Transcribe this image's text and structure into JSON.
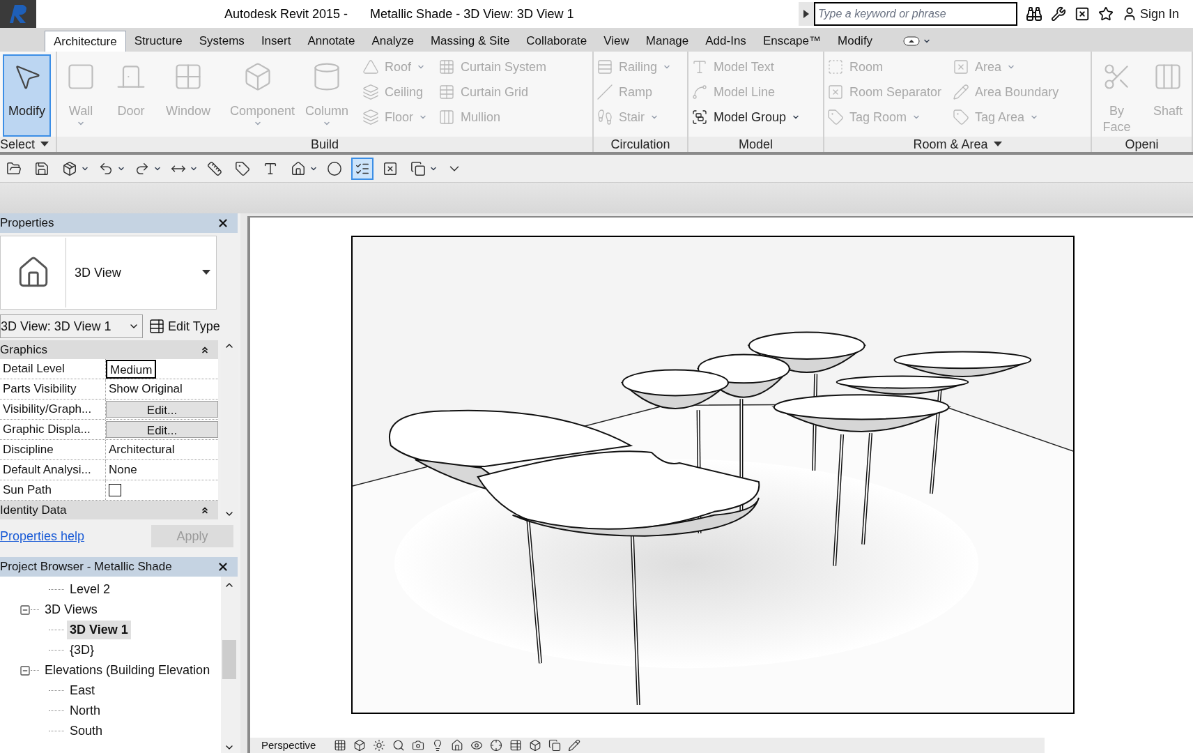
{
  "window": {
    "app_title": "Autodesk Revit 2015 -",
    "doc_title": "Metallic Shade - 3D View: 3D View 1"
  },
  "search": {
    "placeholder": "Type a keyword or phrase"
  },
  "sign_in": "Sign In",
  "tabs": [
    {
      "label": "Architecture",
      "selected": true
    },
    {
      "label": "Structure",
      "selected": false
    },
    {
      "label": "Systems",
      "selected": false
    },
    {
      "label": "Insert",
      "selected": false
    },
    {
      "label": "Annotate",
      "selected": false
    },
    {
      "label": "Analyze",
      "selected": false
    },
    {
      "label": "Massing & Site",
      "selected": false
    },
    {
      "label": "Collaborate",
      "selected": false
    },
    {
      "label": "View",
      "selected": false
    },
    {
      "label": "Manage",
      "selected": false
    },
    {
      "label": "Add-Ins",
      "selected": false
    },
    {
      "label": "Enscape™",
      "selected": false
    },
    {
      "label": "Modify",
      "selected": false
    }
  ],
  "ribbon_panels": [
    {
      "label": "Select",
      "menu": true,
      "large": [
        {
          "label": "Modify",
          "active": true,
          "disabled": false,
          "dropdown": false
        }
      ]
    },
    {
      "label": "Build",
      "menu": false,
      "large": [
        {
          "label": "Wall",
          "active": false,
          "disabled": true,
          "dropdown": true
        },
        {
          "label": "Door",
          "active": false,
          "disabled": true,
          "dropdown": false
        },
        {
          "label": "Window",
          "active": false,
          "disabled": true,
          "dropdown": false
        },
        {
          "label": "Component",
          "active": false,
          "disabled": true,
          "dropdown": true
        },
        {
          "label": "Column",
          "active": false,
          "disabled": true,
          "dropdown": true
        }
      ],
      "columns": [
        [
          {
            "label": "Roof",
            "disabled": true,
            "dropdown": true
          },
          {
            "label": "Ceiling",
            "disabled": true,
            "dropdown": false
          },
          {
            "label": "Floor",
            "disabled": true,
            "dropdown": true
          }
        ],
        [
          {
            "label": "Curtain System",
            "disabled": true,
            "dropdown": false
          },
          {
            "label": "Curtain Grid",
            "disabled": true,
            "dropdown": false
          },
          {
            "label": "Mullion",
            "disabled": true,
            "dropdown": false
          }
        ]
      ]
    },
    {
      "label": "Circulation",
      "menu": false,
      "columns": [
        [
          {
            "label": "Railing",
            "disabled": true,
            "dropdown": true
          },
          {
            "label": "Ramp",
            "disabled": true,
            "dropdown": false
          },
          {
            "label": "Stair",
            "disabled": true,
            "dropdown": true
          }
        ]
      ]
    },
    {
      "label": "Model",
      "menu": false,
      "columns": [
        [
          {
            "label": "Model Text",
            "disabled": true,
            "dropdown": false
          },
          {
            "label": "Model Line",
            "disabled": true,
            "dropdown": false
          },
          {
            "label": "Model Group",
            "disabled": false,
            "dropdown": true
          }
        ]
      ]
    },
    {
      "label": "Room & Area",
      "menu": true,
      "columns": [
        [
          {
            "label": "Room",
            "disabled": true,
            "dropdown": false
          },
          {
            "label": "Room Separator",
            "disabled": true,
            "dropdown": false
          },
          {
            "label": "Tag Room",
            "disabled": true,
            "dropdown": true
          }
        ],
        [
          {
            "label": "Area",
            "disabled": true,
            "dropdown": true
          },
          {
            "label": "Area Boundary",
            "disabled": true,
            "dropdown": false
          },
          {
            "label": "Tag Area",
            "disabled": true,
            "dropdown": true
          }
        ]
      ]
    },
    {
      "label": "Openi",
      "menu": false,
      "large": [
        {
          "label": "By Face",
          "active": false,
          "disabled": true,
          "dropdown": false
        },
        {
          "label": "Shaft",
          "active": false,
          "disabled": true,
          "dropdown": false
        }
      ]
    }
  ],
  "quick_access": [
    {
      "selected": false,
      "dropdown": false
    },
    {
      "selected": false,
      "dropdown": false
    },
    {
      "selected": false,
      "dropdown": true
    },
    {
      "selected": false,
      "dropdown": true
    },
    {
      "selected": false,
      "dropdown": true
    },
    {
      "selected": false,
      "dropdown": true
    },
    {
      "selected": false,
      "dropdown": false
    },
    {
      "selected": false,
      "dropdown": false
    },
    {
      "selected": false,
      "dropdown": false
    },
    {
      "selected": false,
      "dropdown": true
    },
    {
      "selected": false,
      "dropdown": false
    },
    {
      "selected": true,
      "dropdown": false
    },
    {
      "selected": false,
      "dropdown": false
    },
    {
      "selected": false,
      "dropdown": true
    },
    {
      "selected": false,
      "dropdown": false
    }
  ],
  "properties": {
    "title": "Properties",
    "type_name": "3D View",
    "instance": "3D View: 3D View 1",
    "edit_type": "Edit Type",
    "groups": [
      {
        "label": "Graphics",
        "rows": [
          {
            "name": "Detail Level",
            "value": "Medium",
            "kind": "field"
          },
          {
            "name": "Parts Visibility",
            "value": "Show Original",
            "kind": "text"
          },
          {
            "name": "Visibility/Graph...",
            "value": "Edit...",
            "kind": "button"
          },
          {
            "name": "Graphic Displa...",
            "value": "Edit...",
            "kind": "button"
          },
          {
            "name": "Discipline",
            "value": "Architectural",
            "kind": "text"
          },
          {
            "name": "Default Analysi...",
            "value": "None",
            "kind": "text"
          },
          {
            "name": "Sun Path",
            "kind": "checkbox",
            "checked": false
          }
        ]
      },
      {
        "label": "Identity Data"
      }
    ],
    "help_link": "Properties help",
    "apply": {
      "label": "Apply",
      "disabled": true
    }
  },
  "browser": {
    "title": "Project Browser - Metallic Shade",
    "tree": [
      {
        "label": "Level 2",
        "kind": "continued",
        "selected": false
      },
      {
        "label": "3D Views",
        "kind": "node",
        "expanded": true,
        "selected": false,
        "children": [
          {
            "label": "3D View 1",
            "selected": true
          },
          {
            "label": "{3D}",
            "selected": false
          }
        ]
      },
      {
        "label": "Elevations (Building Elevation",
        "kind": "node",
        "expanded": true,
        "selected": false,
        "children": [
          {
            "label": "East",
            "selected": false
          },
          {
            "label": "North",
            "selected": false
          },
          {
            "label": "South",
            "selected": false
          }
        ]
      }
    ]
  },
  "view_bar": {
    "label": "Perspective"
  }
}
